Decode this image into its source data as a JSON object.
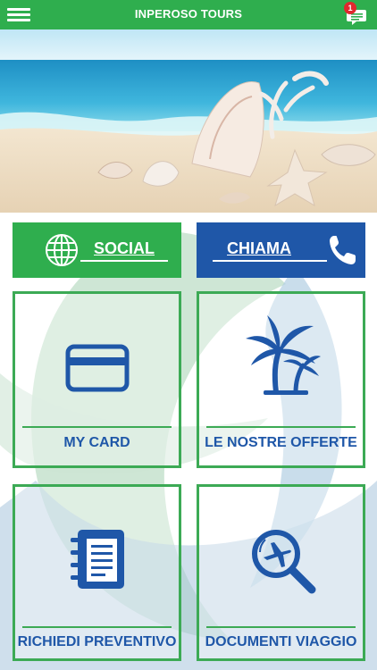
{
  "header": {
    "title": "INPEROSO TOURS",
    "notification_count": "1",
    "icons": {
      "menu": "hamburger-menu-icon",
      "messages": "chat-bubble-icon"
    }
  },
  "actions": {
    "social_label": "SOCIAL",
    "call_label": "CHIAMA"
  },
  "tiles": [
    {
      "label": "MY CARD",
      "icon": "credit-card-icon"
    },
    {
      "label": "LE NOSTRE OFFERTE",
      "icon": "palm-trees-icon"
    },
    {
      "label": "RICHIEDI PREVENTIVO",
      "icon": "notebook-icon"
    },
    {
      "label": "DOCUMENTI VIAGGIO",
      "icon": "plane-search-icon"
    }
  ],
  "colors": {
    "primary_green": "#2fae4e",
    "primary_blue": "#1f57a8",
    "badge_red": "#e0282e",
    "tile_border": "#3caa55"
  }
}
